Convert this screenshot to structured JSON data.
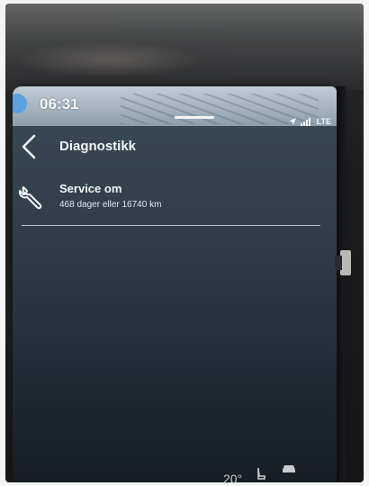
{
  "statusbar": {
    "time": "06:31",
    "network": "LTE"
  },
  "header": {
    "title": "Diagnostikk"
  },
  "service": {
    "title": "Service om",
    "detail": "468 dager eller 16740 km"
  },
  "climate_bar": {
    "temperature": "20°"
  },
  "icons": {
    "back": "chevron-left-icon",
    "service": "wrench-icon",
    "location": "navigation-arrow-icon",
    "signal": "signal-bars-icon",
    "seat": "seat-heat-icon",
    "car": "car-icon"
  },
  "colors": {
    "screen_top": "#3a4a56",
    "screen_bottom": "#161d24",
    "statusbar": "#a8b8c4",
    "text": "#f2f4f6",
    "accent_dot": "#5fa7e6"
  }
}
